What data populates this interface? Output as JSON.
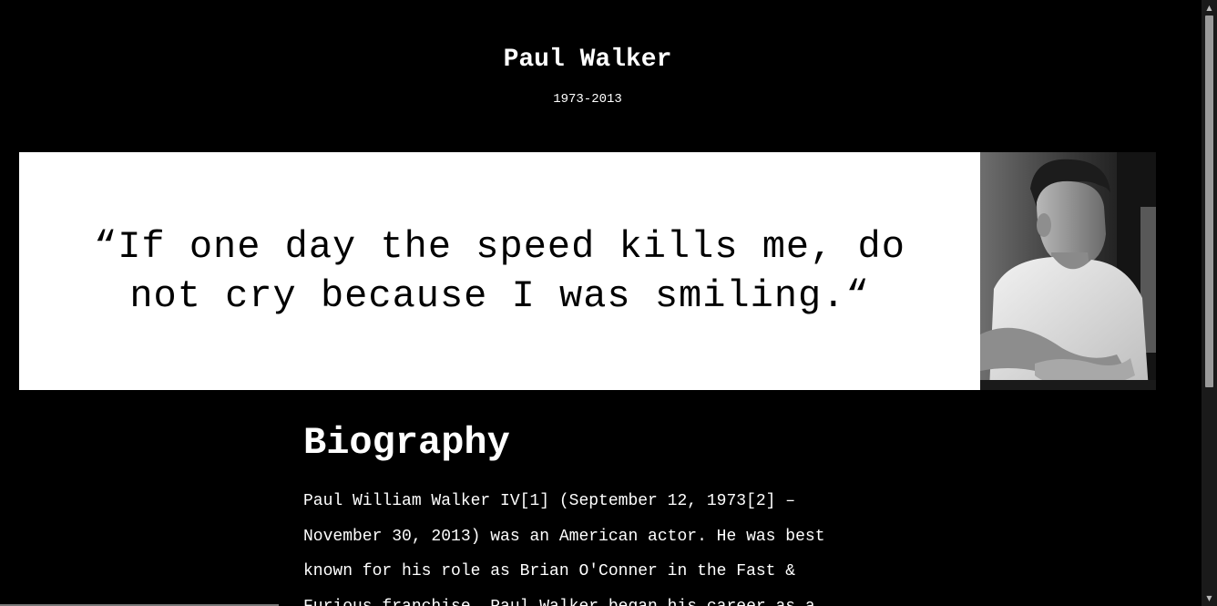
{
  "header": {
    "name": "Paul Walker",
    "years": "1973-2013"
  },
  "banner": {
    "quote": "“If one day the speed kills me, do not cry because I was smiling.“",
    "portrait_icon": "portrait-photo"
  },
  "biography": {
    "heading": "Biography",
    "text": "Paul William Walker IV[1] (September 12, 1973[2] – November 30, 2013) was an American actor. He was best known for his role as Brian O'Conner in the Fast & Furious franchise. Paul Walker began his career as a"
  },
  "scrollbar": {
    "up_arrow": "▲",
    "down_arrow": "▼"
  }
}
